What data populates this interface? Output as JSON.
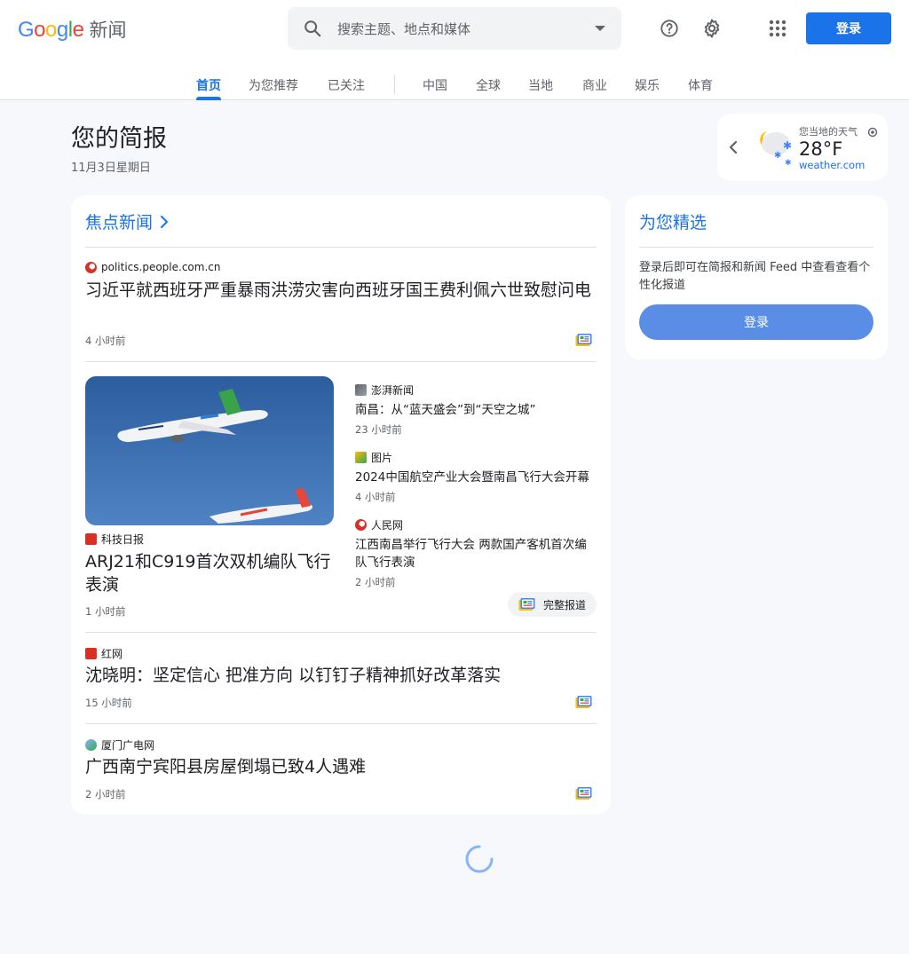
{
  "header": {
    "logo_letters": [
      "G",
      "o",
      "o",
      "g",
      "l",
      "e"
    ],
    "logo_product": "新闻",
    "search_placeholder": "搜索主题、地点和媒体",
    "login_label": "登录",
    "icons": [
      "search-icon",
      "chevron-down-icon",
      "help-icon",
      "gear-icon",
      "apps-grid-icon"
    ]
  },
  "tabs": [
    {
      "label": "首页",
      "active": true
    },
    {
      "label": "为您推荐"
    },
    {
      "label": "已关注"
    },
    {
      "label": "中国"
    },
    {
      "label": "全球"
    },
    {
      "label": "当地"
    },
    {
      "label": "商业"
    },
    {
      "label": "娱乐"
    },
    {
      "label": "体育"
    }
  ],
  "briefing": {
    "title": "您的简报",
    "date": "11月3日星期日"
  },
  "weather": {
    "label": "您当地的天气",
    "temp": "28°F",
    "source": "weather.com"
  },
  "top_stories": {
    "heading": "焦点新闻",
    "stories": [
      {
        "source": "politics.people.com.cn",
        "headline": "习近平就西班牙严重暴雨洪涝灾害向西班牙国王费利佩六世致慰问电",
        "time": "4 小时前"
      },
      {
        "source": "科技日报",
        "headline": "ARJ21和C919首次双机编队飞行表演",
        "time": "1 小时前"
      },
      {
        "source": "红网",
        "headline": "沈晓明：坚定信心 把准方向 以钉钉子精神抓好改革落实",
        "time": "15 小时前"
      },
      {
        "source": "厦门广电网",
        "headline": "广西南宁宾阳县房屋倒塌已致4人遇难",
        "time": "2 小时前"
      }
    ],
    "related": [
      {
        "source": "澎湃新闻",
        "headline": "南昌：从“蓝天盛会”到“天空之城”",
        "time": "23 小时前"
      },
      {
        "source": "图片",
        "headline": "2024中国航空产业大会暨南昌飞行大会开幕",
        "time": "4 小时前"
      },
      {
        "source": "人民网",
        "headline": "江西南昌举行飞行大会 两款国产客机首次编队飞行表演",
        "time": "2 小时前"
      }
    ],
    "full_coverage_label": "完整报道"
  },
  "picks": {
    "heading": "为您精选",
    "text": "登录后即可在简报和新闻 Feed 中查看查看个性化报道",
    "login_label": "登录"
  },
  "colors": {
    "accent": "#1a73e8",
    "background": "#f6f8fc"
  }
}
